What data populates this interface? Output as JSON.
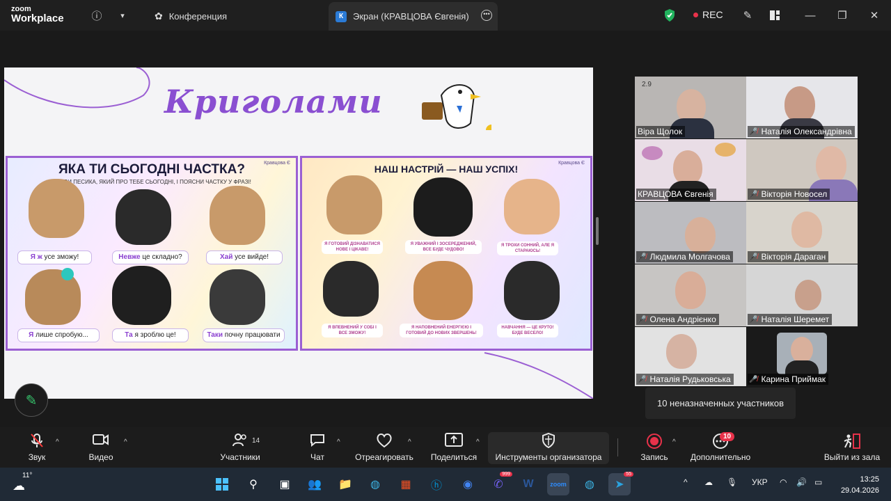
{
  "window": {
    "brand_top": "zoom",
    "brand_bottom": "Workplace",
    "tab_conference": "Конференция",
    "tab_screen_initial": "К",
    "tab_screen": "Экран (КРАВЦОВА Євгенія)",
    "rec_label": "REC"
  },
  "slide": {
    "title": "Криголами",
    "left_panel": {
      "heading": "ЯКА ТИ СЬОГОДНІ ЧАСТКА?",
      "subheading": "ОБЕРИ ПЕСИКА, ЯКИЙ ПРО ТЕБЕ СЬОГОДНІ, І ПОЯСНИ ЧАСТКУ У ФРАЗІ!",
      "author": "Кравцова Є",
      "cards": [
        {
          "accent": "Я",
          "em": "ж",
          "rest": " усе зможу!"
        },
        {
          "accent": "Невже",
          "em": "",
          "rest": " це складно?"
        },
        {
          "accent": "Хай",
          "em": "",
          "rest": " усе вийде!"
        },
        {
          "accent": "Я",
          "em": "",
          "rest": " лише спробую..."
        },
        {
          "accent": "Та",
          "em": "",
          "rest": " я зроблю це!"
        },
        {
          "accent": "Таки",
          "em": "",
          "rest": " почну працювати"
        }
      ]
    },
    "right_panel": {
      "heading": "НАШ НАСТРІЙ — НАШ УСПІХ!",
      "author": "Кравцова Є",
      "bubbles": [
        "Я ГОТОВИЙ ДІЗНАВАТИСЯ НОВЕ І ЦІКАВЕ!",
        "Я УВАЖНИЙ І ЗОСЕРЕДЖЕНИЙ, ВСЕ БУДЕ ЧУДОВО!",
        "Я ТРОХИ СОННИЙ, АЛЕ Я СТАРАЮСЬ!",
        "Я ВПЕВНЕНИЙ У СОБІ І ВСЕ ЗМОЖУ!",
        "Я НАПОВНЕНИЙ ЕНЕРГІЄЮ І ГОТОВИЙ ДО НОВИХ ЗВЕРШЕНЬ!",
        "НАВЧАННЯ — ЦЕ КРУТО! БУДЕ ВЕСЕЛО!"
      ]
    }
  },
  "participants": [
    {
      "name": "Віра Щолок",
      "muted": false,
      "bg": "#b9b6b4",
      "face": "#d7b3a0",
      "label_top": "2.9"
    },
    {
      "name": "Наталія Олександрівна",
      "muted": true,
      "bg": "#e6e6ea",
      "face": "#c79a86",
      "label_top": ""
    },
    {
      "name": "КРАВЦОВА Євгенія",
      "muted": false,
      "bg": "#e9dde6",
      "face": "#d9ae9a",
      "label_top": ""
    },
    {
      "name": "Вікторія Новосел",
      "muted": true,
      "bg": "#cfc8c0",
      "face": "#e0b9a6",
      "label_top": ""
    },
    {
      "name": "Людмила Молгачова",
      "muted": true,
      "bg": "#bcbcc0",
      "face": "#d8b09a",
      "label_top": ""
    },
    {
      "name": "Вікторія Дараган",
      "muted": true,
      "bg": "#d8d4cc",
      "face": "#dfb9a3",
      "label_top": ""
    },
    {
      "name": "Олена Андрієнко",
      "muted": true,
      "bg": "#c7c5c3",
      "face": "#d9ad98",
      "label_top": ""
    },
    {
      "name": "Наталія Шеремет",
      "muted": true,
      "bg": "#d6d6d6",
      "face": "#c8a08c",
      "label_top": ""
    },
    {
      "name": "Наталія Рудьковська",
      "muted": true,
      "bg": "#e2e2e2",
      "face": "#d6b3a3",
      "label_top": ""
    },
    {
      "name": "Карина Приймак",
      "muted": true,
      "bg": "#1e1e1e",
      "face": "#d9b09c",
      "label_top": ""
    }
  ],
  "tooltip": "10 неназначенных участников",
  "toolbar": {
    "audio": "Звук",
    "video": "Видео",
    "participants": "Участники",
    "participants_count": "14",
    "chat": "Чат",
    "react": "Отреагировать",
    "share": "Поделиться",
    "host_tools": "Инструменты организатора",
    "record": "Запись",
    "more": "Дополнительно",
    "more_badge": "10",
    "leave": "Выйти из зала"
  },
  "taskbar": {
    "weather_temp": "11°",
    "viber_badge": "999",
    "tg_badge": "55",
    "lang": "УКР",
    "time": "13:25",
    "date": "29.04.2026"
  },
  "colors": {
    "accent_purple": "#8a4fd1",
    "speaker_green": "#36c26b",
    "rec_red": "#e8324a"
  },
  "icons": [
    "info-icon",
    "chevron-down-icon",
    "people-icon",
    "ellipsis-icon",
    "shield-icon",
    "pen-icon",
    "layout-icon",
    "minimize-icon",
    "restore-icon",
    "close-icon",
    "microphone-muted-icon",
    "camera-icon",
    "participants-icon",
    "chat-icon",
    "heart-icon",
    "share-screen-icon",
    "host-shield-icon",
    "record-icon",
    "more-icon",
    "leave-icon",
    "annotation-pen-icon"
  ]
}
